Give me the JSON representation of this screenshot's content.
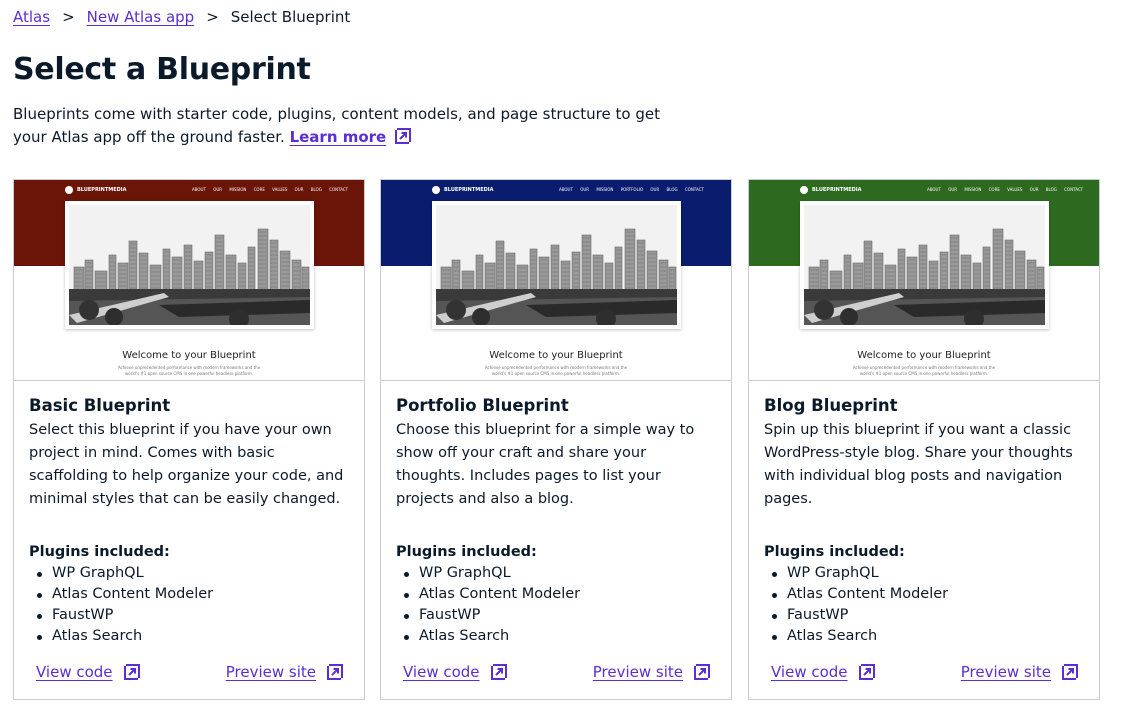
{
  "breadcrumb": {
    "items": [
      "Atlas",
      "New Atlas app"
    ],
    "current": "Select Blueprint",
    "separator": ">"
  },
  "page": {
    "title": "Select a Blueprint",
    "intro": "Blueprints come with starter code, plugins, content models, and page structure to get your Atlas app off the ground faster.",
    "learn_more": "Learn more"
  },
  "cards": [
    {
      "title": "Basic Blueprint",
      "description": "Select this blueprint if you have your own project in mind. Comes with basic scaffolding to help organize your code, and minimal styles that can be easily changed.",
      "plugins_title": "Plugins included:",
      "plugins": [
        "WP GraphQL",
        "Atlas Content Modeler",
        "FaustWP",
        "Atlas Search"
      ],
      "view_code": "View code",
      "preview_site": "Preview site",
      "preview": {
        "band_color": "#6b1508",
        "logo": "BLUEPRINTMEDIA",
        "menu": "ABOUT OUR MISSION CORE VALUES OUR BLOG CONTACT",
        "welcome": "Welcome to your Blueprint",
        "subtext_1": "Achieve unprecedented performance with modern frameworks and the",
        "subtext_2": "world's #1 open source CMS in one powerful headless platform."
      }
    },
    {
      "title": "Portfolio Blueprint",
      "description": "Choose this blueprint for a simple way to show off your craft and share your thoughts. Includes pages to list your projects and also a blog.",
      "plugins_title": "Plugins included:",
      "plugins": [
        "WP GraphQL",
        "Atlas Content Modeler",
        "FaustWP",
        "Atlas Search"
      ],
      "view_code": "View code",
      "preview_site": "Preview site",
      "preview": {
        "band_color": "#0a1c6e",
        "logo": "BLUEPRINTMEDIA",
        "menu": "ABOUT OUR MISSION PORTFOLIO OUR BLOG CONTACT",
        "welcome": "Welcome to your Blueprint",
        "subtext_1": "Achieve unprecedented performance with modern frameworks and the",
        "subtext_2": "world's #1 open source CMS in one powerful headless platform."
      }
    },
    {
      "title": "Blog Blueprint",
      "description": "Spin up this blueprint if you want a classic WordPress-style blog. Share your thoughts with individual blog posts and navigation pages.",
      "plugins_title": "Plugins included:",
      "plugins": [
        "WP GraphQL",
        "Atlas Content Modeler",
        "FaustWP",
        "Atlas Search"
      ],
      "view_code": "View code",
      "preview_site": "Preview site",
      "preview": {
        "band_color": "#2d6a1f",
        "logo": "BLUEPRINTMEDIA",
        "menu": "ABOUT OUR MISSION CORE VALUES OUR BLOG CONTACT",
        "welcome": "Welcome to your Blueprint",
        "subtext_1": "Achieve unprecedented performance with modern frameworks and the",
        "subtext_2": "world's #1 open source CMS in one powerful headless platform."
      }
    }
  ],
  "colors": {
    "link": "#5a2ed1",
    "text": "#0b1a2b",
    "border": "#c9ccd6"
  },
  "icons": {
    "external_link": "external-link-icon",
    "breadcrumb_separator": "chevron-right-icon",
    "search": "search-icon"
  }
}
